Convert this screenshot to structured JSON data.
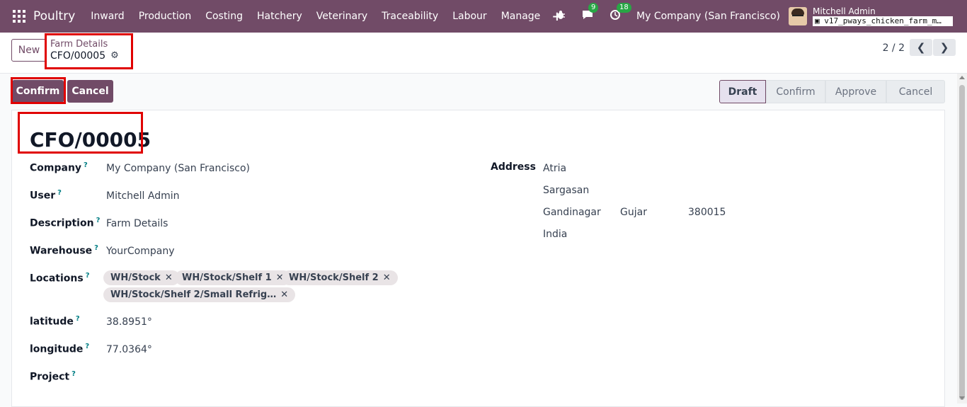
{
  "topbar": {
    "app_name": "Poultry",
    "menu": [
      "Inward",
      "Production",
      "Costing",
      "Hatchery",
      "Veterinary",
      "Traceability",
      "Labour",
      "Manage"
    ],
    "plus_icon": "+",
    "chat_badge": "9",
    "activity_badge": "18",
    "company": "My Company (San Francisco)",
    "user_name": "Mitchell Admin",
    "db_name": "v17_pways_chicken_farm_m…"
  },
  "control": {
    "new_label": "New",
    "breadcrumb_parent": "Farm Details",
    "breadcrumb_current": "CFO/00005",
    "pager": "2 / 2"
  },
  "actions": {
    "confirm_label": "Confirm",
    "cancel_label": "Cancel"
  },
  "status": {
    "stages": [
      "Draft",
      "Confirm",
      "Approve",
      "Cancel"
    ],
    "active": "Draft"
  },
  "record": {
    "title": "CFO/00005",
    "labels": {
      "company": "Company",
      "user": "User",
      "description": "Description",
      "warehouse": "Warehouse",
      "locations": "Locations",
      "latitude": "latitude",
      "longitude": "longitude",
      "project": "Project",
      "address": "Address"
    },
    "help_mark": "?",
    "company": "My Company (San Francisco)",
    "user": "Mitchell Admin",
    "description": "Farm Details",
    "warehouse": "YourCompany",
    "locations": [
      "WH/Stock",
      "WH/Stock/Shelf 1",
      "WH/Stock/Shelf 2",
      "WH/Stock/Shelf 2/Small Refrig…"
    ],
    "latitude": "38.8951°",
    "longitude": "77.0364°",
    "project": "",
    "address": {
      "street": "Atria",
      "street2": "Sargasan",
      "city": "Gandinagar",
      "state": "Gujara",
      "zip": "380015",
      "country": "India"
    }
  },
  "colors": {
    "brand": "#714b67",
    "highlight": "#e00000",
    "badge": "#28a745"
  }
}
